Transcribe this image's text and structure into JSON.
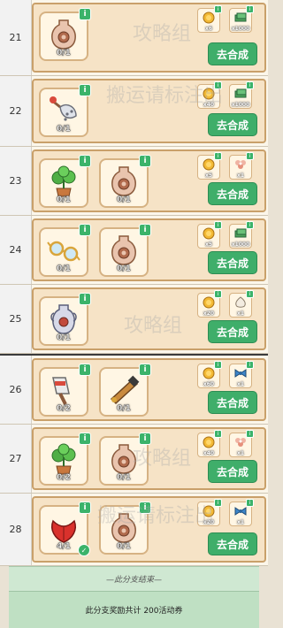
{
  "rows": [
    {
      "number": "21",
      "items": [
        {
          "icon": "vase-icon",
          "count": "0/1"
        }
      ],
      "rewards": [
        {
          "icon": "gold-coin-icon",
          "qty": "x6"
        },
        {
          "icon": "cash-stack-icon",
          "qty": "x1000"
        }
      ],
      "button": "去合成"
    },
    {
      "number": "22",
      "items": [
        {
          "icon": "fan-icon",
          "count": "0/1"
        }
      ],
      "rewards": [
        {
          "icon": "gold-coin-icon",
          "qty": "x40"
        },
        {
          "icon": "cash-stack-icon",
          "qty": "x1000"
        }
      ],
      "button": "去合成"
    },
    {
      "number": "23",
      "items": [
        {
          "icon": "plant-pot-icon",
          "count": "0/1"
        },
        {
          "icon": "vase-icon",
          "count": "0/1"
        }
      ],
      "rewards": [
        {
          "icon": "gold-coin-icon",
          "qty": "x5"
        },
        {
          "icon": "flower-icon",
          "qty": "x1"
        }
      ],
      "button": "去合成"
    },
    {
      "number": "24",
      "items": [
        {
          "icon": "glasses-icon",
          "count": "0/1"
        },
        {
          "icon": "vase-icon",
          "count": "0/1"
        }
      ],
      "rewards": [
        {
          "icon": "gold-coin-icon",
          "qty": "x5"
        },
        {
          "icon": "cash-stack-icon",
          "qty": "x1000"
        }
      ],
      "button": "去合成"
    },
    {
      "number": "25",
      "items": [
        {
          "icon": "amphora-icon",
          "count": "0/1"
        }
      ],
      "rewards": [
        {
          "icon": "gold-coin-icon",
          "qty": "x20"
        },
        {
          "icon": "garlic-icon",
          "qty": "x1"
        }
      ],
      "button": "去合成"
    },
    {
      "number": "26",
      "items": [
        {
          "icon": "paint-tube-icon",
          "count": "0/2"
        },
        {
          "icon": "telescope-icon",
          "count": "0/1"
        }
      ],
      "rewards": [
        {
          "icon": "gold-coin-icon",
          "qty": "x60"
        },
        {
          "icon": "blue-bow-icon",
          "qty": "x1"
        }
      ],
      "button": "去合成"
    },
    {
      "number": "27",
      "items": [
        {
          "icon": "plant-pot-icon",
          "count": "0/2"
        },
        {
          "icon": "vase-icon",
          "count": "0/1"
        }
      ],
      "rewards": [
        {
          "icon": "gold-coin-icon",
          "qty": "x40"
        },
        {
          "icon": "flower-icon",
          "qty": "x1"
        }
      ],
      "button": "去合成"
    },
    {
      "number": "28",
      "items": [
        {
          "icon": "red-flower-icon",
          "count": "4/1",
          "done": true
        },
        {
          "icon": "vase-icon",
          "count": "0/1"
        }
      ],
      "rewards": [
        {
          "icon": "gold-coin-icon",
          "qty": "x20"
        },
        {
          "icon": "blue-bow-icon",
          "qty": "x1"
        }
      ],
      "button": "去合成"
    }
  ],
  "footer": {
    "end_text": "—此分支结束—",
    "total_text": "此分支奖励共计 200活动券"
  },
  "watermarks": [
    "攻略组",
    "搬运请标注出",
    "攻略组",
    "搬运请标注出",
    "攻略组"
  ],
  "colors": {
    "accent": "#3fae6a",
    "panel": "#f6e3c6",
    "border": "#c9a06a"
  }
}
